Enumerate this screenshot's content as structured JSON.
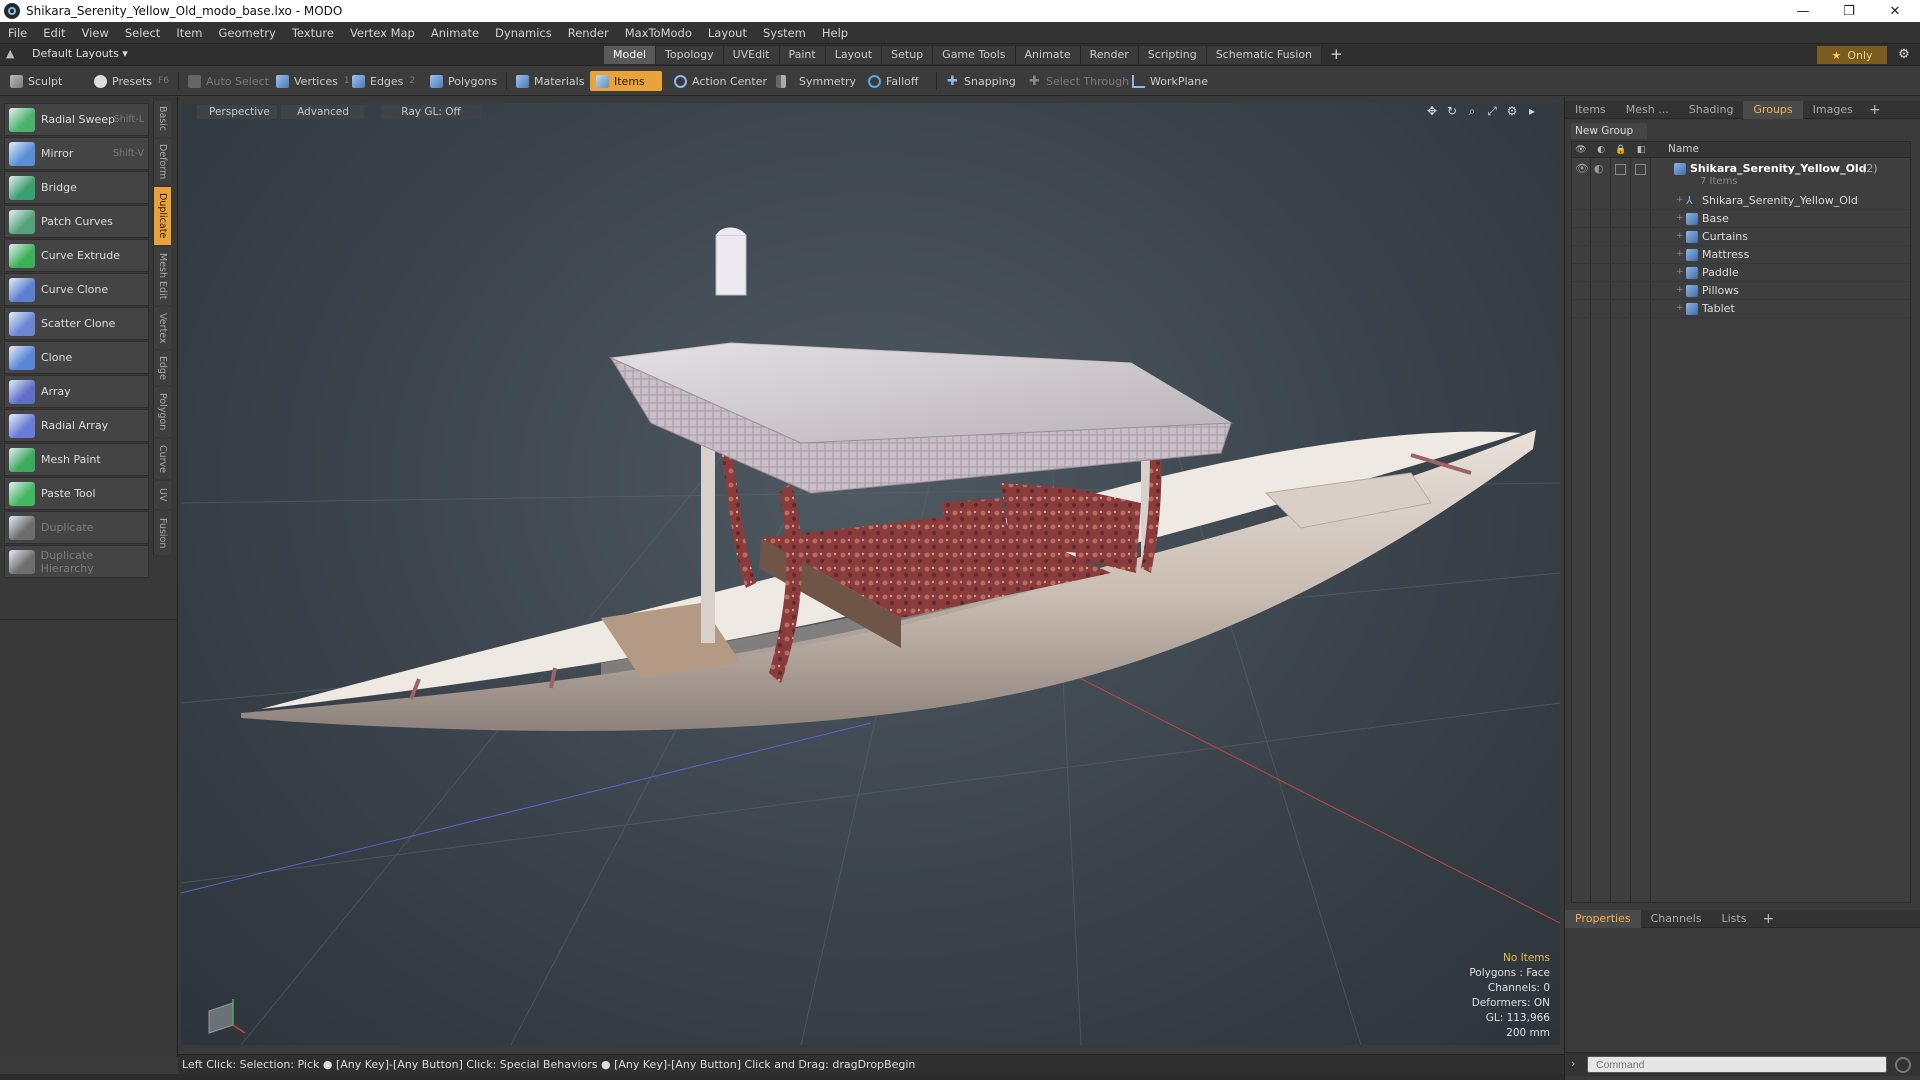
{
  "window": {
    "title": "Shikara_Serenity_Yellow_Old_modo_base.lxo - MODO",
    "controls": [
      "—",
      "❐",
      "✕"
    ]
  },
  "menu": [
    "File",
    "Edit",
    "View",
    "Select",
    "Item",
    "Geometry",
    "Texture",
    "Vertex Map",
    "Animate",
    "Dynamics",
    "Render",
    "MaxToModo",
    "Layout",
    "System",
    "Help"
  ],
  "layouts": {
    "label": "Default Layouts ▾"
  },
  "main_tabs": [
    {
      "label": "Model",
      "active": true
    },
    {
      "label": "Topology"
    },
    {
      "label": "UVEdit"
    },
    {
      "label": "Paint"
    },
    {
      "label": "Layout"
    },
    {
      "label": "Setup"
    },
    {
      "label": "Game Tools"
    },
    {
      "label": "Animate"
    },
    {
      "label": "Render"
    },
    {
      "label": "Scripting"
    },
    {
      "label": "Schematic Fusion"
    }
  ],
  "only_label": "Only",
  "toolbar": {
    "sculpt": "Sculpt",
    "presets": "Presets",
    "presets_key": "F6",
    "auto_select": "Auto Select",
    "vertices": "Vertices",
    "vertices_count": "1",
    "edges": "Edges",
    "edges_count": "2",
    "polygons": "Polygons",
    "materials": "Materials",
    "items": "Items",
    "action_center": "Action Center",
    "symmetry": "Symmetry",
    "falloff": "Falloff",
    "snapping": "Snapping",
    "select_through": "Select Through",
    "workplane": "WorkPlane"
  },
  "tools": [
    {
      "label": "Radial Sweep",
      "shortcut": "Shift-L",
      "color": "#4bb36b"
    },
    {
      "label": "Mirror",
      "shortcut": "Shift-V",
      "color": "#5a8fd6"
    },
    {
      "label": "Bridge",
      "shortcut": "",
      "color": "#3aa070"
    },
    {
      "label": "Patch Curves",
      "shortcut": "",
      "color": "#56a27a"
    },
    {
      "label": "Curve Extrude",
      "shortcut": "",
      "color": "#3cb15a"
    },
    {
      "label": "Curve Clone",
      "shortcut": "",
      "color": "#5d7fd0"
    },
    {
      "label": "Scatter Clone",
      "shortcut": "",
      "color": "#6a86d4"
    },
    {
      "label": "Clone",
      "shortcut": "",
      "color": "#5a86d8"
    },
    {
      "label": "Array",
      "shortcut": "",
      "color": "#5f6fc8"
    },
    {
      "label": "Radial Array",
      "shortcut": "",
      "color": "#6a7bd6"
    },
    {
      "label": "Mesh Paint",
      "shortcut": "",
      "color": "#3eaa5e"
    },
    {
      "label": "Paste Tool",
      "shortcut": "",
      "color": "#44b760"
    },
    {
      "label": "Duplicate",
      "shortcut": "",
      "color": "#6d6d6d",
      "disabled": true
    },
    {
      "label": "Duplicate Hierarchy",
      "shortcut": "",
      "color": "#6d6d6d",
      "disabled": true
    }
  ],
  "side_tabs": [
    {
      "label": "Basic"
    },
    {
      "label": "Deform"
    },
    {
      "label": "Duplicate",
      "active": true
    },
    {
      "label": "Mesh Edit"
    },
    {
      "label": "Vertex"
    },
    {
      "label": "Edge"
    },
    {
      "label": "Polygon"
    },
    {
      "label": "Curve"
    },
    {
      "label": "UV"
    },
    {
      "label": "Fusion"
    }
  ],
  "viewport": {
    "view": "Perspective",
    "shading": "Advanced",
    "raygl": "Ray GL: Off",
    "stats": {
      "items": "No Items",
      "polygons": "Polygons : Face",
      "channels": "Channels: 0",
      "deformers": "Deformers: ON",
      "gl": "GL: 113,966",
      "scale": "200 mm"
    }
  },
  "status": "Left Click: Selection: Pick ● [Any Key]-[Any Button] Click: Special Behaviors ● [Any Key]-[Any Button] Click and Drag: dragDropBegin",
  "groups_panel": {
    "tabs": [
      {
        "label": "Items"
      },
      {
        "label": "Mesh ..."
      },
      {
        "label": "Shading"
      },
      {
        "label": "Groups",
        "active": true
      },
      {
        "label": "Images"
      }
    ],
    "new_group": "New Group",
    "column_name": "Name",
    "root": {
      "label": "Shikara_Serenity_Yellow_Old",
      "count": "(2)",
      "sub": "7 Items"
    },
    "children": [
      "Shikara_Serenity_Yellow_Old",
      "Base",
      "Curtains",
      "Mattress",
      "Paddle",
      "Pillows",
      "Tablet"
    ]
  },
  "properties_panel": {
    "tabs": [
      {
        "label": "Properties",
        "active": true
      },
      {
        "label": "Channels"
      },
      {
        "label": "Lists"
      }
    ]
  },
  "command": {
    "placeholder": "Command"
  },
  "colors": {
    "accent": "#e8a33b",
    "active_tab_text": "#f3b24a"
  }
}
